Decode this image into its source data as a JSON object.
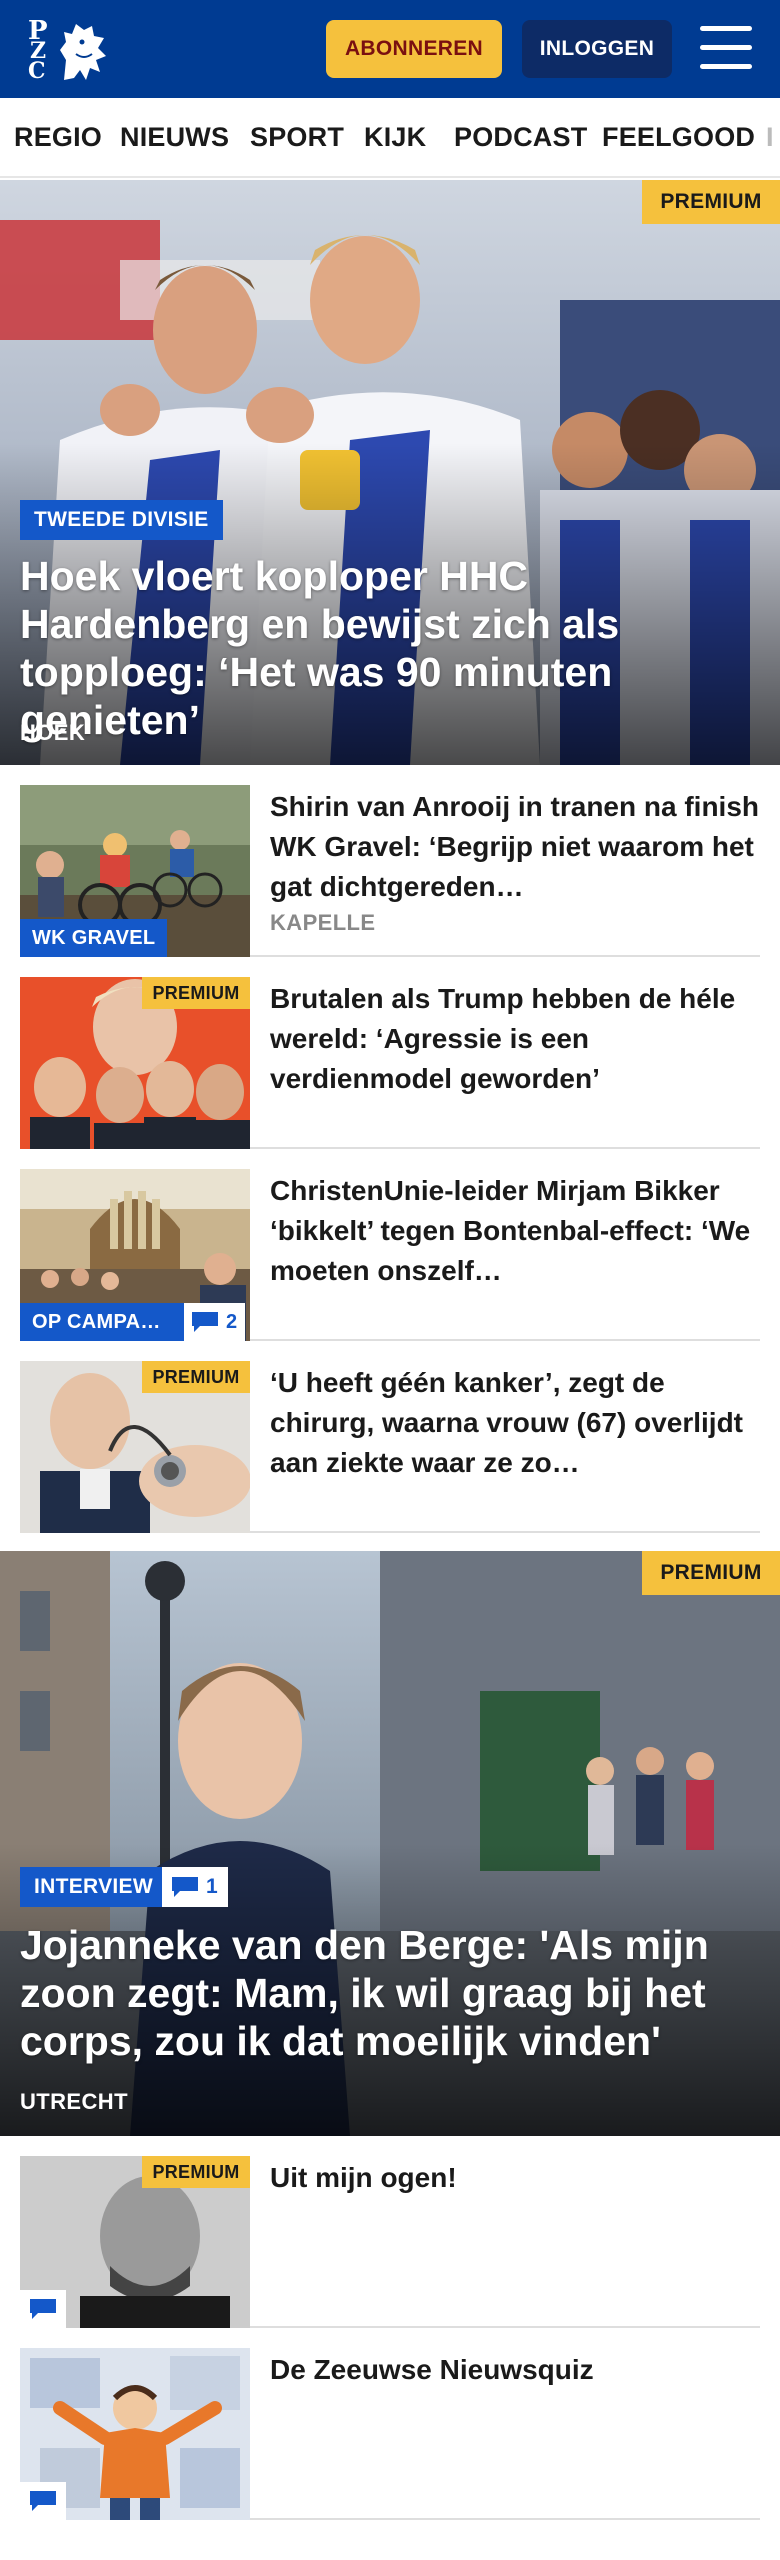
{
  "header": {
    "logo_letters": [
      "P",
      "Z",
      "C"
    ],
    "subscribe_label": "ABONNEREN",
    "login_label": "INLOGGEN",
    "brand_color": "#003b92",
    "accent_color": "#f5c13d"
  },
  "nav": {
    "items": [
      "REGIO",
      "NIEUWS",
      "SPORT",
      "KIJK",
      "PODCAST",
      "FEELGOOD",
      "I"
    ]
  },
  "hero1": {
    "premium": "PREMIUM",
    "label": "TWEEDE DIVISIE",
    "title": "Hoek vloert koploper HHC Hardenberg en bewijst zich als topploeg: ‘Het was 90 minuten genieten’",
    "location": "HOEK"
  },
  "articles1": [
    {
      "title": "Shirin van Anrooij in tranen na finish WK Gravel: ‘Begrijp niet waarom het gat dichtgereden…",
      "location": "KAPELLE",
      "label": "WK GRAVEL",
      "thumb_icon": "cyclists-photo"
    },
    {
      "title": "Brutalen als Trump hebben de héle wereld: ‘Agressie is een verdienmodel geworden’",
      "premium": "PREMIUM",
      "thumb_icon": "politicians-collage"
    },
    {
      "title": "ChristenUnie-leider Mirjam Bikker ‘bikkelt’ tegen Bontenbal-effect: ‘We moeten onszelf…",
      "label": "OP CAMPA…",
      "comments": "2",
      "thumb_icon": "church-interior-photo"
    },
    {
      "title": "‘U heeft géén kanker’, zegt de chirurg, waarna vrouw (67) overlijdt aan ziekte waar ze zo…",
      "premium": "PREMIUM",
      "thumb_icon": "doctor-stethoscope-photo"
    }
  ],
  "hero2": {
    "premium": "PREMIUM",
    "label": "INTERVIEW",
    "comments": "1",
    "title": "Jojanneke van den Berge: 'Als mijn zoon zegt: Mam, ik wil graag bij het corps, zou ik dat moeilijk vinden'",
    "location": "UTRECHT"
  },
  "articles2": [
    {
      "title": "Uit mijn ogen!",
      "premium": "PREMIUM",
      "thumb_icon": "columnist-portrait"
    },
    {
      "title": "De Zeeuwse Nieuwsquiz",
      "thumb_icon": "quiz-cartoon-illustration"
    }
  ]
}
